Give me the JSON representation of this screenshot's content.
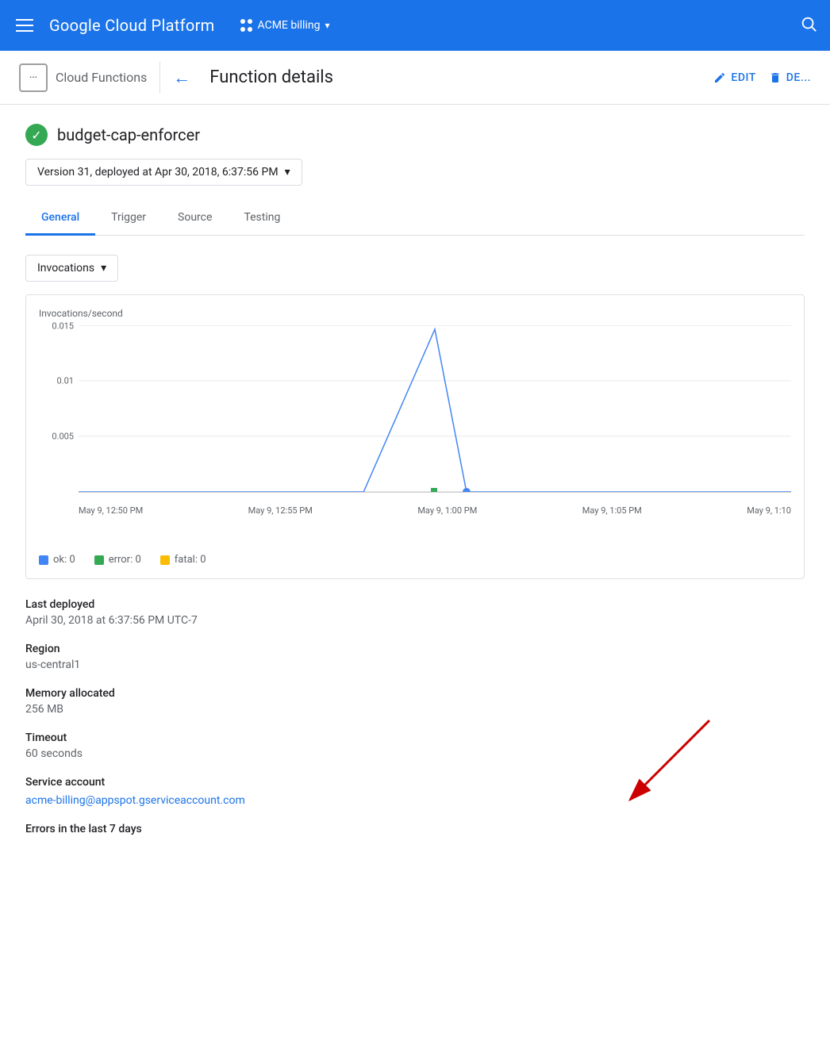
{
  "nav": {
    "menu_icon": "menu",
    "title": "Google Cloud Platform",
    "billing": "ACME billing",
    "search_icon": "search"
  },
  "sub_header": {
    "brand_icon_text": "···",
    "brand_name": "Cloud Functions",
    "page_title": "Function details",
    "edit_label": "EDIT",
    "delete_label": "DE..."
  },
  "function": {
    "name": "budget-cap-enforcer",
    "status": "ok",
    "version_label": "Version 31, deployed at Apr 30, 2018, 6:37:56 PM"
  },
  "tabs": [
    {
      "label": "General",
      "active": true
    },
    {
      "label": "Trigger",
      "active": false
    },
    {
      "label": "Source",
      "active": false
    },
    {
      "label": "Testing",
      "active": false
    }
  ],
  "chart": {
    "dropdown_label": "Invocations",
    "y_axis_label": "Invocations/second",
    "y_labels": [
      "0.015",
      "0.01",
      "0.005"
    ],
    "x_labels": [
      "May 9, 12:50 PM",
      "May 9, 12:55 PM",
      "May 9, 1:00 PM",
      "May 9, 1:05 PM",
      "May 9, 1:10"
    ],
    "legend": [
      {
        "label": "ok: 0",
        "color": "#4285f4"
      },
      {
        "label": "error: 0",
        "color": "#34a853"
      },
      {
        "label": "fatal: 0",
        "color": "#fbbc04"
      }
    ]
  },
  "details": {
    "last_deployed_label": "Last deployed",
    "last_deployed_value": "April 30, 2018 at 6:37:56 PM UTC-7",
    "region_label": "Region",
    "region_value": "us-central1",
    "memory_label": "Memory allocated",
    "memory_value": "256 MB",
    "timeout_label": "Timeout",
    "timeout_value": "60 seconds",
    "service_account_label": "Service account",
    "service_account_value": "acme-billing@appspot.gserviceaccount.com",
    "errors_label": "Errors in the last 7 days"
  }
}
